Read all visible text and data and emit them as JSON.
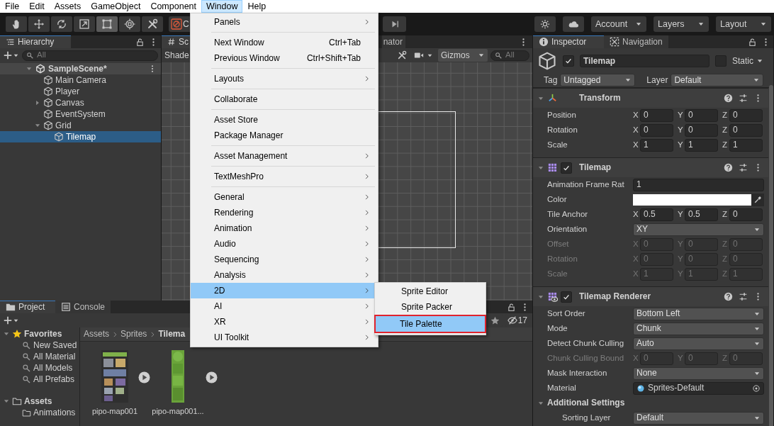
{
  "menubar": [
    {
      "label": "File",
      "selected": false
    },
    {
      "label": "Edit",
      "selected": false
    },
    {
      "label": "Assets",
      "selected": false
    },
    {
      "label": "GameObject",
      "selected": false
    },
    {
      "label": "Component",
      "selected": false
    },
    {
      "label": "Window",
      "selected": true
    },
    {
      "label": "Help",
      "selected": false
    }
  ],
  "toolbar": {
    "tools": [
      {
        "kind": "hand",
        "selected": false
      },
      {
        "kind": "move",
        "selected": false
      },
      {
        "kind": "rotate",
        "selected": false
      },
      {
        "kind": "scale",
        "selected": false
      },
      {
        "kind": "rect",
        "selected": true
      },
      {
        "kind": "transform",
        "selected": false
      },
      {
        "kind": "custom",
        "selected": false
      }
    ],
    "cut_button": "C",
    "account": "Account",
    "layers": "Layers",
    "layout": "Layout"
  },
  "hierarchy": {
    "tab": "Hierarchy",
    "search": {
      "placeholder": "All"
    },
    "scene": {
      "label": "SampleScene*",
      "expanded": true
    },
    "items": [
      {
        "label": "Main Camera",
        "selected": false
      },
      {
        "label": "Player",
        "selected": false
      },
      {
        "label": "Canvas",
        "selected": false,
        "expanded": false
      },
      {
        "label": "EventSystem",
        "selected": false
      },
      {
        "label": "Grid",
        "selected": false,
        "expanded": true,
        "children": [
          {
            "label": "Tilemap",
            "selected": true
          }
        ]
      }
    ]
  },
  "scene_view": {
    "tabs": [
      {
        "label": "Sc",
        "selected": true
      },
      {
        "label": "nator",
        "selected": false
      }
    ],
    "shading": "Shade",
    "gizmos": "Gizmos",
    "search": {
      "placeholder": "All"
    }
  },
  "window_menu": {
    "sections": [
      [
        {
          "label": "Panels",
          "has_submenu": true,
          "selected": false
        }
      ],
      [
        {
          "label": "Next Window",
          "shortcut": "Ctrl+Tab",
          "has_submenu": false,
          "selected": false
        },
        {
          "label": "Previous Window",
          "shortcut": "Ctrl+Shift+Tab",
          "has_submenu": false,
          "selected": false
        }
      ],
      [
        {
          "label": "Layouts",
          "has_submenu": true,
          "selected": false
        }
      ],
      [
        {
          "label": "Collaborate",
          "has_submenu": false,
          "selected": false
        }
      ],
      [
        {
          "label": "Asset Store",
          "has_submenu": false,
          "selected": false
        },
        {
          "label": "Package Manager",
          "has_submenu": false,
          "selected": false
        }
      ],
      [
        {
          "label": "Asset Management",
          "has_submenu": true,
          "selected": false
        }
      ],
      [
        {
          "label": "TextMeshPro",
          "has_submenu": true,
          "selected": false
        }
      ],
      [
        {
          "label": "General",
          "has_submenu": true,
          "selected": false
        },
        {
          "label": "Rendering",
          "has_submenu": true,
          "selected": false
        },
        {
          "label": "Animation",
          "has_submenu": true,
          "selected": false
        },
        {
          "label": "Audio",
          "has_submenu": true,
          "selected": false
        },
        {
          "label": "Sequencing",
          "has_submenu": true,
          "selected": false
        },
        {
          "label": "Analysis",
          "has_submenu": true,
          "selected": false
        },
        {
          "label": "2D",
          "has_submenu": true,
          "selected": true
        },
        {
          "label": "AI",
          "has_submenu": true,
          "selected": false
        },
        {
          "label": "XR",
          "has_submenu": true,
          "selected": false
        },
        {
          "label": "UI Toolkit",
          "has_submenu": true,
          "selected": false
        }
      ]
    ],
    "submenu": [
      {
        "label": "Sprite Editor",
        "selected": false,
        "outlined": false
      },
      {
        "label": "Sprite Packer",
        "selected": false,
        "outlined": false
      },
      {
        "label": "Tile Palette",
        "selected": true,
        "outlined": true
      }
    ]
  },
  "project": {
    "tabs": [
      {
        "label": "Project",
        "selected": true
      },
      {
        "label": "Console",
        "selected": false
      }
    ],
    "hidden_count": "17",
    "favorites": {
      "label": "Favorites",
      "expanded": true,
      "items": [
        "New Saved",
        "All Material",
        "All Models",
        "All Prefabs"
      ]
    },
    "assets": {
      "label": "Assets",
      "expanded": true,
      "items": [
        "Animations"
      ]
    },
    "breadcrumb": [
      "Assets",
      "Sprites",
      "Tilema"
    ],
    "files": [
      {
        "name": "pipo-map001"
      },
      {
        "name": "pipo-map001..."
      }
    ]
  },
  "inspector": {
    "tabs": [
      {
        "label": "Inspector",
        "selected": true
      },
      {
        "label": "Navigation",
        "selected": false
      }
    ],
    "object": {
      "name": "Tilemap",
      "active": true,
      "static": false,
      "static_label": "Static",
      "tag_label": "Tag",
      "tag": "Untagged",
      "layer_label": "Layer",
      "layer": "Default"
    },
    "components": [
      {
        "title": "Transform",
        "kind": "transform",
        "expanded": true,
        "properties": [
          {
            "label": "Position",
            "kind": "vector",
            "values": [
              {
                "axis": "X",
                "value": "0"
              },
              {
                "axis": "Y",
                "value": "0"
              },
              {
                "axis": "Z",
                "value": "0"
              }
            ]
          },
          {
            "label": "Rotation",
            "kind": "vector",
            "values": [
              {
                "axis": "X",
                "value": "0"
              },
              {
                "axis": "Y",
                "value": "0"
              },
              {
                "axis": "Z",
                "value": "0"
              }
            ]
          },
          {
            "label": "Scale",
            "kind": "vector",
            "values": [
              {
                "axis": "X",
                "value": "1"
              },
              {
                "axis": "Y",
                "value": "1"
              },
              {
                "axis": "Z",
                "value": "1"
              }
            ]
          }
        ]
      },
      {
        "title": "Tilemap",
        "kind": "tilemap",
        "enabled": true,
        "expanded": true,
        "properties": [
          {
            "label": "Animation Frame Rat",
            "kind": "field",
            "value": "1"
          },
          {
            "label": "Color",
            "kind": "color",
            "color": "#ffffff"
          },
          {
            "label": "Tile Anchor",
            "kind": "vector",
            "values": [
              {
                "axis": "X",
                "value": "0.5"
              },
              {
                "axis": "Y",
                "value": "0.5"
              },
              {
                "axis": "Z",
                "value": "0"
              }
            ]
          },
          {
            "label": "Orientation",
            "kind": "dropdown",
            "value": "XY"
          },
          {
            "label": "Offset",
            "kind": "vector",
            "disabled": true,
            "values": [
              {
                "axis": "X",
                "value": "0"
              },
              {
                "axis": "Y",
                "value": "0"
              },
              {
                "axis": "Z",
                "value": "0"
              }
            ]
          },
          {
            "label": "Rotation",
            "kind": "vector",
            "disabled": true,
            "values": [
              {
                "axis": "X",
                "value": "0"
              },
              {
                "axis": "Y",
                "value": "0"
              },
              {
                "axis": "Z",
                "value": "0"
              }
            ]
          },
          {
            "label": "Scale",
            "kind": "vector",
            "disabled": true,
            "values": [
              {
                "axis": "X",
                "value": "1"
              },
              {
                "axis": "Y",
                "value": "1"
              },
              {
                "axis": "Z",
                "value": "1"
              }
            ]
          }
        ]
      },
      {
        "title": "Tilemap Renderer",
        "kind": "renderer",
        "enabled": true,
        "expanded": true,
        "properties": [
          {
            "label": "Sort Order",
            "kind": "dropdown",
            "value": "Bottom Left"
          },
          {
            "label": "Mode",
            "kind": "dropdown",
            "value": "Chunk"
          },
          {
            "label": "Detect Chunk Culling",
            "kind": "dropdown",
            "value": "Auto"
          },
          {
            "label": "Chunk Culling Bound",
            "kind": "vector",
            "disabled": true,
            "values": [
              {
                "axis": "X",
                "value": "0"
              },
              {
                "axis": "Y",
                "value": "0"
              },
              {
                "axis": "Z",
                "value": "0"
              }
            ]
          },
          {
            "label": "Mask Interaction",
            "kind": "dropdown",
            "value": "None"
          },
          {
            "label": "Material",
            "kind": "object",
            "value": "Sprites-Default"
          },
          {
            "label": "Additional Settings",
            "kind": "foldout",
            "expanded": true,
            "children": [
              {
                "label": "Sorting Layer",
                "kind": "dropdown",
                "value": "Default"
              }
            ]
          }
        ]
      }
    ]
  }
}
